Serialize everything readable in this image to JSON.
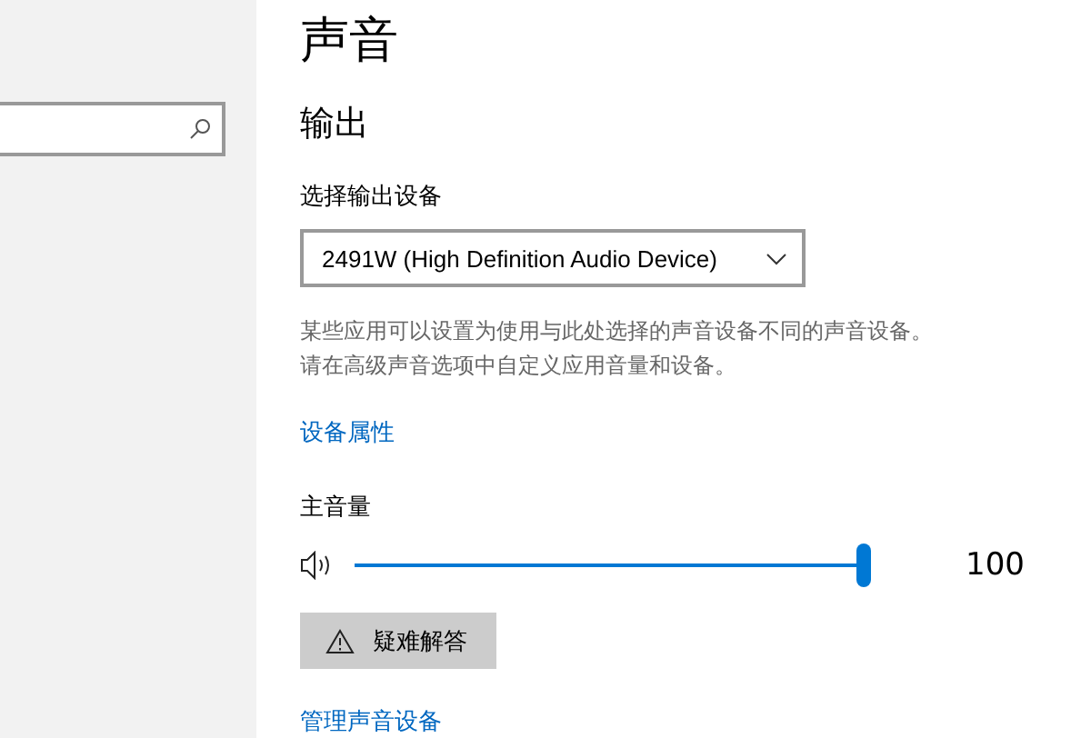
{
  "sidebar": {
    "search": {
      "kind": "search"
    }
  },
  "page": {
    "title": "声音",
    "section": "输出",
    "device_label": "选择输出设备",
    "device_select": {
      "value": "2491W (High Definition Audio Device)"
    },
    "description": [
      "某些应用可以设置为使用与此处选择的声音设备不同的声音设备。",
      "请在高级声音选项中自定义应用音量和设备。"
    ],
    "device_properties_link": "设备属性",
    "volume": {
      "label": "主音量",
      "level": 1,
      "reading": "100"
    },
    "troubleshoot_button": "疑难解答",
    "manage_link": "管理声音设备"
  }
}
